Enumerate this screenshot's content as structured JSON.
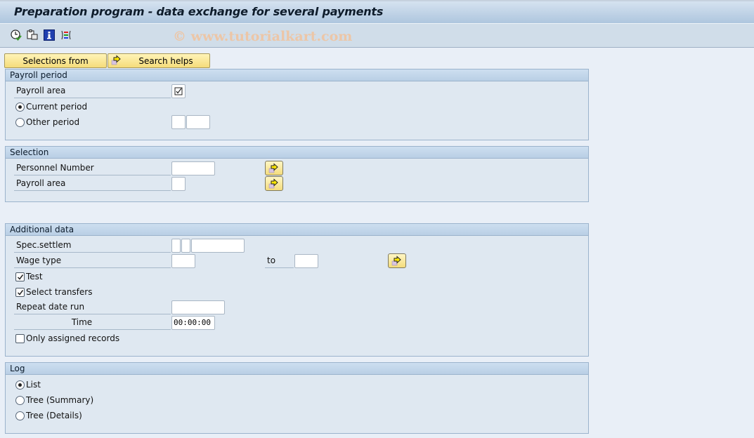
{
  "window": {
    "title": "Preparation program - data exchange for several payments",
    "watermark": "© www.tutorialkart.com"
  },
  "toolbar": {
    "icons": [
      "execute-background-icon",
      "get-variant-icon",
      "program-info-icon",
      "layout-icon"
    ]
  },
  "buttons": {
    "selections_from": "Selections from",
    "search_helps": "Search helps"
  },
  "payroll_period": {
    "title": "Payroll period",
    "payroll_area_label": "Payroll area",
    "payroll_area_checked": true,
    "current_period_label": "Current period",
    "current_period_selected": true,
    "other_period_label": "Other period",
    "other_period_selected": false,
    "other_period_value1": "",
    "other_period_value2": ""
  },
  "selection": {
    "title": "Selection",
    "personnel_number_label": "Personnel Number",
    "personnel_number_value": "",
    "payroll_area_label": "Payroll area",
    "payroll_area_value": ""
  },
  "additional_data": {
    "title": "Additional data",
    "spec_settlem_label": "Spec.settlem",
    "spec_settlem_values": [
      "",
      "",
      ""
    ],
    "wage_type_label": "Wage type",
    "wage_type_from": "",
    "wage_type_to_label": "to",
    "wage_type_to": "",
    "test_label": "Test",
    "test_checked": true,
    "select_transfers_label": "Select transfers",
    "select_transfers_checked": true,
    "repeat_date_run_label": "Repeat date run",
    "repeat_date_run_value": "",
    "time_label": "Time",
    "time_value": "00:00:00",
    "only_assigned_label": "Only assigned records",
    "only_assigned_checked": false
  },
  "log": {
    "title": "Log",
    "options": [
      {
        "label": "List",
        "selected": true
      },
      {
        "label": "Tree (Summary)",
        "selected": false
      },
      {
        "label": "Tree (Details)",
        "selected": false
      }
    ]
  },
  "colors": {
    "button_yellow": "#f5dc7a",
    "group_header": "#b9cfe5",
    "background": "#e9eff7"
  }
}
